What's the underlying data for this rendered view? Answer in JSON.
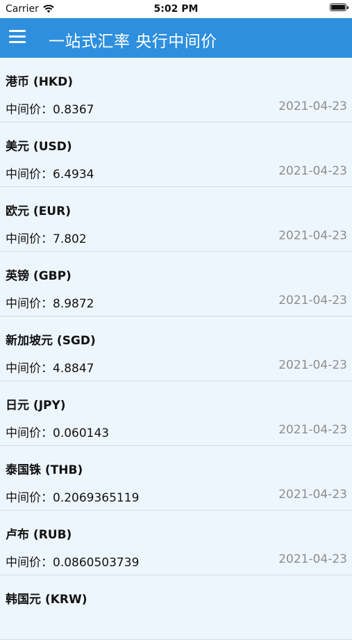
{
  "status_bar": {
    "carrier": "Carrier",
    "time": "5:02 PM"
  },
  "nav": {
    "title": "一站式汇率 央行中间价"
  },
  "price_label": "中间价：",
  "rates": [
    {
      "name": "港币 (HKD)",
      "value": "0.8367",
      "date": "2021-04-23"
    },
    {
      "name": "美元 (USD)",
      "value": "6.4934",
      "date": "2021-04-23"
    },
    {
      "name": "欧元 (EUR)",
      "value": "7.802",
      "date": "2021-04-23"
    },
    {
      "name": "英镑 (GBP)",
      "value": "8.9872",
      "date": "2021-04-23"
    },
    {
      "name": "新加坡元 (SGD)",
      "value": "4.8847",
      "date": "2021-04-23"
    },
    {
      "name": "日元 (JPY)",
      "value": "0.060143",
      "date": "2021-04-23"
    },
    {
      "name": "泰国铢 (THB)",
      "value": "0.2069365119",
      "date": "2021-04-23"
    },
    {
      "name": "卢布 (RUB)",
      "value": "0.0860503739",
      "date": "2021-04-23"
    },
    {
      "name": "韩国元 (KRW)"
    }
  ]
}
